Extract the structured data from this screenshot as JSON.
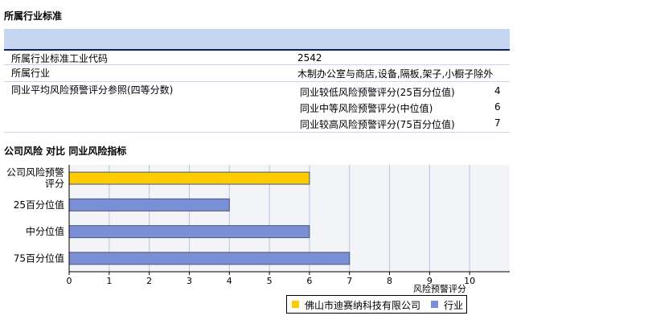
{
  "header": {
    "title": "所属行业标准"
  },
  "info_table": {
    "rows": [
      {
        "label": "所属行业标准工业代码",
        "value": "2542"
      },
      {
        "label": "所属行业",
        "value": "木制办公室与商店,设备,隔板,架子,小橱子除外"
      },
      {
        "label": "同业平均风险预警评分参照(四等分数)"
      }
    ],
    "percentiles": [
      {
        "label": "同业较低风险预警评分(25百分位值)",
        "value": "4"
      },
      {
        "label": "同业中等风险预警评分(中位值)",
        "value": "6"
      },
      {
        "label": "同业较高风险预警评分(75百分位值)",
        "value": "7"
      }
    ]
  },
  "chart_section": {
    "title": "公司风险  对比  同业风险指标"
  },
  "chart_data": {
    "type": "bar",
    "orientation": "horizontal",
    "categories": [
      "公司风险预警评分",
      "25百分位值",
      "中分位值",
      "75百分位值"
    ],
    "category_lines": [
      [
        "公司风险预警",
        "评分"
      ],
      [
        "25百分位值"
      ],
      [
        "中分位值"
      ],
      [
        "75百分位值"
      ]
    ],
    "values": [
      6,
      4,
      6,
      7
    ],
    "bar_series": [
      "佛山市迪赛纳科技有限公司",
      "行业",
      "行业",
      "行业"
    ],
    "series": [
      {
        "name": "佛山市迪赛纳科技有限公司",
        "color": "#ffcc00"
      },
      {
        "name": "行业",
        "color": "#7b8fd6"
      }
    ],
    "xlabel": "风险预警评分",
    "xlim": [
      0,
      11
    ],
    "xticks": [
      0,
      1,
      2,
      3,
      4,
      5,
      6,
      7,
      8,
      9,
      10
    ],
    "grid": true,
    "legend_position": "bottom-right"
  },
  "colors": {
    "header_band": "#c6d6f0",
    "header_rule": "#0c1f63",
    "plot_bg": "#f2f4f8",
    "grid": "#b8c4e4"
  }
}
